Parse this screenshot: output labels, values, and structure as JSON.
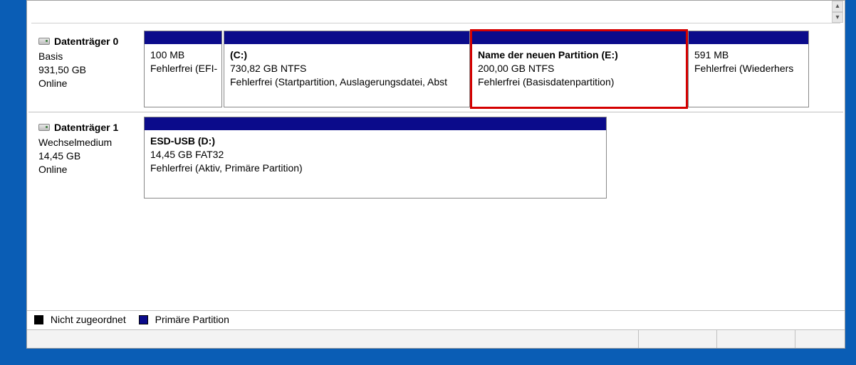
{
  "disks": [
    {
      "icon": "disk-icon",
      "name": "Datenträger 0",
      "type": "Basis",
      "capacity": "931,50 GB",
      "status": "Online",
      "partitions": [
        {
          "name": "",
          "size": "100 MB",
          "status": "Fehlerfrei (EFI-"
        },
        {
          "name": " (C:)",
          "size": "730,82 GB NTFS",
          "status": "Fehlerfrei (Startpartition, Auslagerungsdatei, Abst"
        },
        {
          "name": "Name der neuen Partition  (E:)",
          "size": "200,00 GB NTFS",
          "status": "Fehlerfrei (Basisdatenpartition)"
        },
        {
          "name": "",
          "size": "591 MB",
          "status": "Fehlerfrei (Wiederhers"
        }
      ]
    },
    {
      "icon": "disk-icon",
      "name": "Datenträger 1",
      "type": "Wechselmedium",
      "capacity": "14,45 GB",
      "status": "Online",
      "partitions": [
        {
          "name": "ESD-USB  (D:)",
          "size": "14,45 GB FAT32",
          "status": "Fehlerfrei (Aktiv, Primäre Partition)"
        }
      ]
    }
  ],
  "legend": {
    "unallocated": "Nicht zugeordnet",
    "primary": "Primäre Partition"
  }
}
